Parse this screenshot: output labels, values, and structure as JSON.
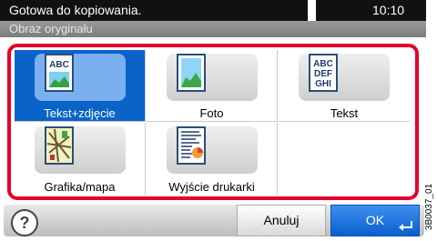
{
  "status": {
    "message": "Gotowa do kopiowania.",
    "time": "10:10"
  },
  "subtitle": "Obraz oryginału",
  "options": [
    {
      "label": "Tekst+zdjęcie",
      "icon": "text-photo-icon",
      "selected": true
    },
    {
      "label": "Foto",
      "icon": "photo-icon",
      "selected": false
    },
    {
      "label": "Tekst",
      "icon": "text-icon",
      "selected": false
    },
    {
      "label": "Grafika/mapa",
      "icon": "map-icon",
      "selected": false
    },
    {
      "label": "Wyjście drukarki",
      "icon": "printer-output-icon",
      "selected": false
    }
  ],
  "icon_text": {
    "text_photo": "ABC",
    "text_lines": [
      "ABC",
      "DEF",
      "GHI"
    ]
  },
  "buttons": {
    "cancel": "Anuluj",
    "ok": "OK",
    "help": "?"
  },
  "code": "3B0037_01",
  "colors": {
    "accent_red": "#e4002b",
    "selected_blue": "#0a63c9",
    "ok_blue": "#1a74e0"
  }
}
